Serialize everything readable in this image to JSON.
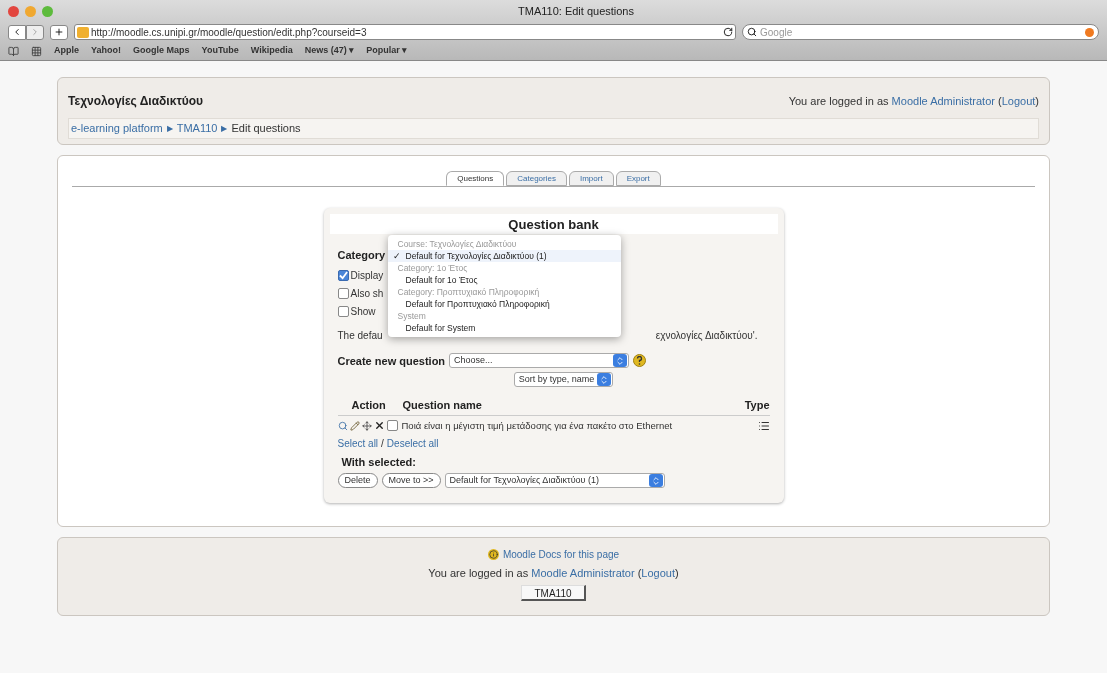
{
  "browser": {
    "title": "TMA110: Edit questions",
    "url": "http://moodle.cs.unipi.gr/moodle/question/edit.php?courseid=3",
    "search_placeholder": "Google",
    "bookmarks": [
      "Apple",
      "Yahoo!",
      "Google Maps",
      "YouTube",
      "Wikipedia",
      "News (47) ▾",
      "Popular ▾"
    ]
  },
  "header": {
    "site_title": "Τεχνολογίες Διαδικτύου",
    "login": {
      "prefix": "You are logged in as",
      "user": "Moodle Administrator",
      "open": "(",
      "logout": "Logout",
      "close": ")"
    },
    "breadcrumb": [
      {
        "kind": "link",
        "label": "e-learning platform"
      },
      {
        "kind": "sep",
        "label": "▶"
      },
      {
        "kind": "link",
        "label": "TMA110"
      },
      {
        "kind": "sep",
        "label": "▶"
      },
      {
        "kind": "text",
        "label": "Edit questions"
      }
    ]
  },
  "tabs": [
    {
      "label": "Questions",
      "selected": true
    },
    {
      "label": "Categories",
      "selected": false
    },
    {
      "label": "Import",
      "selected": false
    },
    {
      "label": "Export",
      "selected": false
    }
  ],
  "question_bank": {
    "title": "Question bank",
    "category_label": "Category",
    "options": [
      {
        "label": "Display",
        "checked": true
      },
      {
        "label": "Also sh",
        "checked": false
      },
      {
        "label": "Show",
        "checked": false
      }
    ],
    "note_start": "The defau",
    "note_end": "εχνολογίες Διαδικτύου'.",
    "dropdown": {
      "check": "✓",
      "items": [
        {
          "kind": "group",
          "label": "Course: Τεχνολογίες Διαδικτύου"
        },
        {
          "kind": "option",
          "label": "Default for Τεχνολογίες Διαδικτύου (1)",
          "selected": true
        },
        {
          "kind": "group",
          "label": "Category: 1ο Έτος"
        },
        {
          "kind": "option",
          "label": "Default for 1ο Έτος",
          "selected": false
        },
        {
          "kind": "group",
          "label": "Category: Προπτυχιακό Πληροφορική"
        },
        {
          "kind": "option",
          "label": "Default for Προπτυχιακό Πληροφορική",
          "selected": false
        },
        {
          "kind": "group",
          "label": "System"
        },
        {
          "kind": "option",
          "label": "Default for System",
          "selected": false
        }
      ]
    },
    "create_label": "Create new question",
    "create_value": "Choose...",
    "sort_value": "Sort by type, name",
    "columns": [
      "Action",
      "Question name",
      "Type"
    ],
    "questions": [
      {
        "name": "Ποιά είναι η μέγιστη τιμή μετάδοσης για ένα πακέτο στο Ethernet",
        "checked": false
      }
    ],
    "select_all": "Select all",
    "slash": "/",
    "deselect_all": "Deselect all",
    "with_selected": "With selected:",
    "buttons": [
      "Delete",
      "Move to >>"
    ],
    "move_target": "Default for Τεχνολογίες Διαδικτύου (1)"
  },
  "footer": {
    "docs_link": "Moodle Docs for this page",
    "login": {
      "prefix": "You are logged in as",
      "user": "Moodle Administrator",
      "open": "(",
      "logout": "Logout",
      "close": ")"
    },
    "course_button": "TMA110"
  }
}
